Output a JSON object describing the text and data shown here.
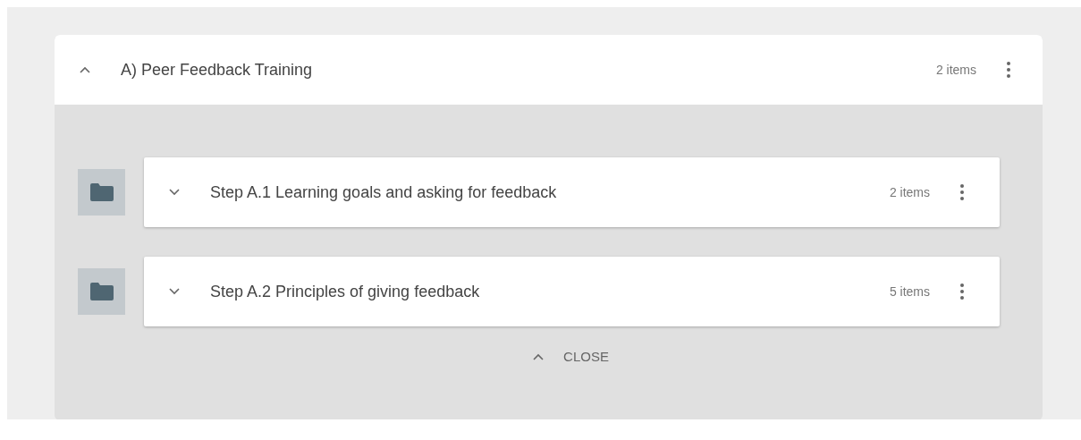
{
  "section": {
    "title": "A) Peer Feedback Training",
    "count": "2 items",
    "expanded": true,
    "steps": [
      {
        "title": "Step A.1 Learning goals and asking for feedback",
        "count": "2 items",
        "expanded": false
      },
      {
        "title": "Step A.2 Principles of giving feedback",
        "count": "5 items",
        "expanded": false
      }
    ],
    "close_label": "CLOSE"
  }
}
